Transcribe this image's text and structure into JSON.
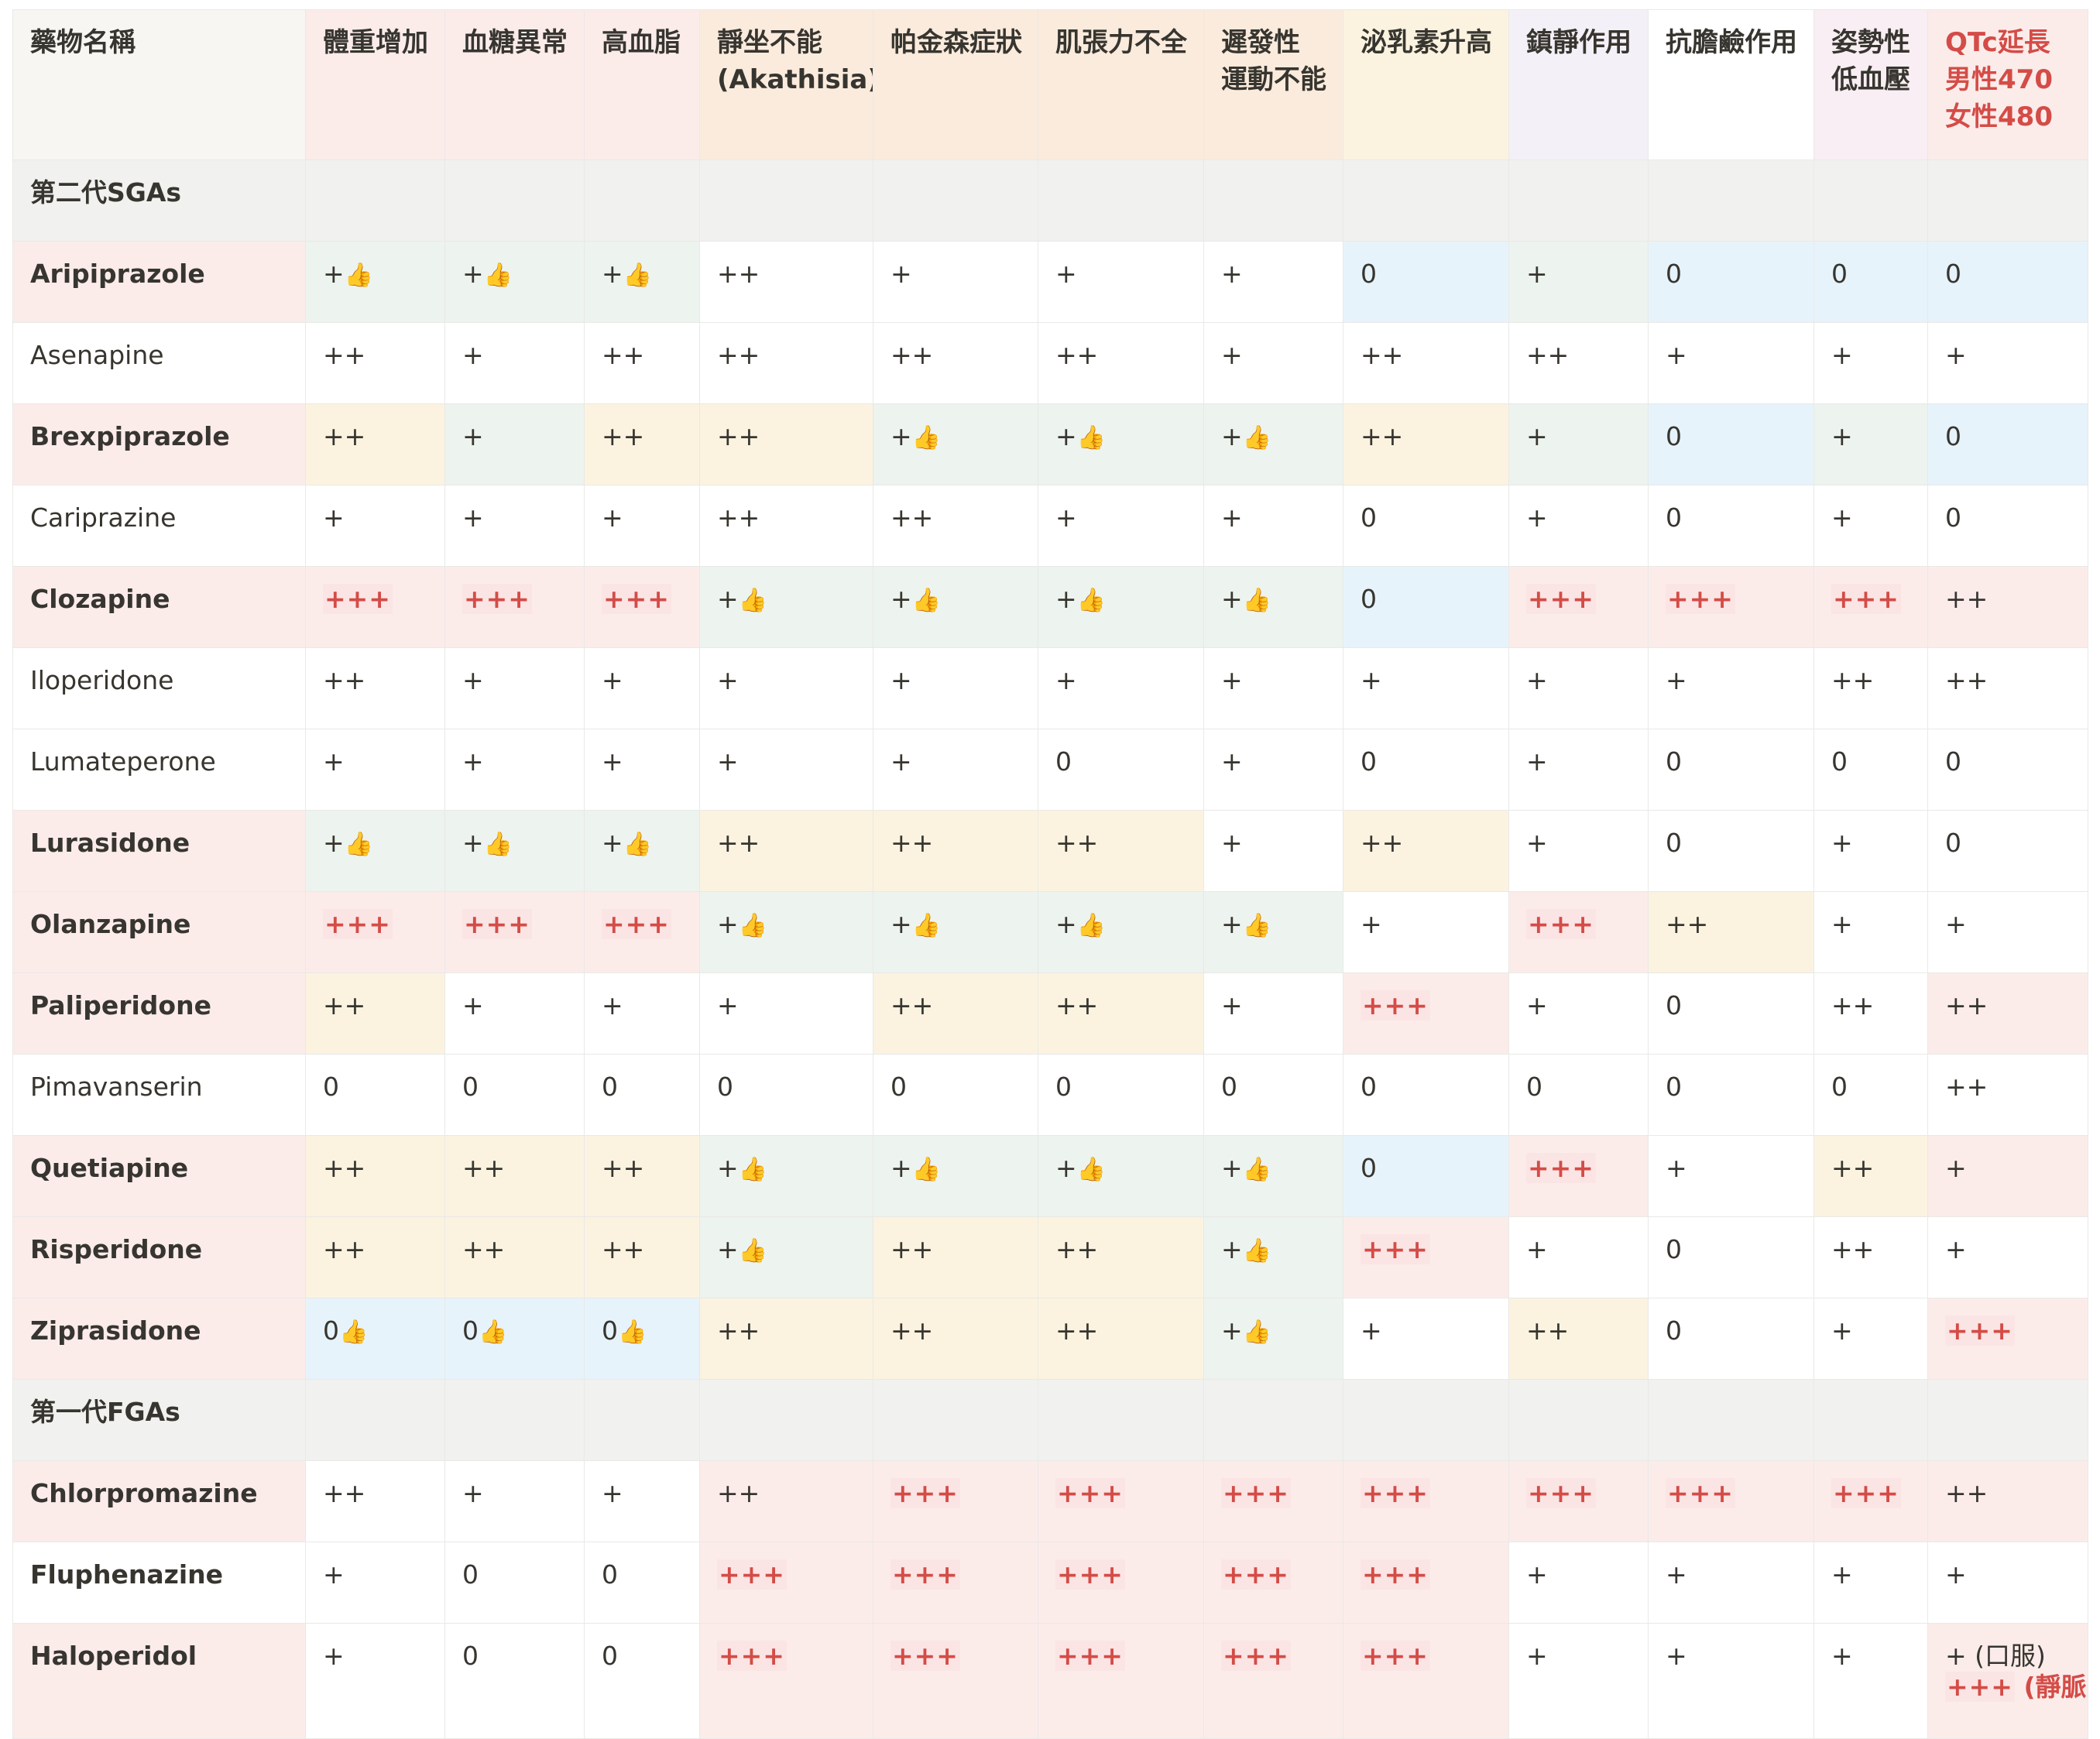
{
  "columns": [
    {
      "label": "藥物名稱",
      "bg": "bg-gray"
    },
    {
      "label": "體重增加",
      "bg": "bg-red"
    },
    {
      "label": "血糖異常",
      "bg": "bg-red"
    },
    {
      "label": "高血脂",
      "bg": "bg-red"
    },
    {
      "label": "靜坐不能\n(Akathisia)",
      "bg": "bg-orange"
    },
    {
      "label": "帕金森症狀",
      "bg": "bg-orange"
    },
    {
      "label": "肌張力不全",
      "bg": "bg-orange"
    },
    {
      "label": "遲發性\n運動不能",
      "bg": "bg-orange"
    },
    {
      "label": "泌乳素升高",
      "bg": "bg-yellow"
    },
    {
      "label": "鎮靜作用",
      "bg": "bg-purple"
    },
    {
      "label": "抗膽鹼作用",
      "bg": "bg-white"
    },
    {
      "label": "姿勢性\n低血壓",
      "bg": "bg-pink"
    },
    {
      "label": "QTc延長\n男性470\n女性480",
      "bg": "bg-red",
      "red": true
    }
  ],
  "rows": [
    {
      "section": "第二代SGAs"
    },
    {
      "name": "Aripiprazole",
      "bold": true,
      "nameBg": "bg-red",
      "cells": [
        [
          "+",
          "g",
          true
        ],
        [
          "+",
          "g",
          true
        ],
        [
          "+",
          "g",
          true
        ],
        [
          "++",
          "w"
        ],
        [
          "+",
          "w"
        ],
        [
          "+",
          "w"
        ],
        [
          "+",
          "w"
        ],
        [
          "0",
          "b"
        ],
        [
          "+",
          "g"
        ],
        [
          "0",
          "b"
        ],
        [
          "0",
          "b"
        ],
        [
          "0",
          "b"
        ]
      ]
    },
    {
      "name": "Asenapine",
      "bold": false,
      "nameBg": "bg-white",
      "cells": [
        [
          "++",
          "w"
        ],
        [
          "+",
          "w"
        ],
        [
          "++",
          "w"
        ],
        [
          "++",
          "w"
        ],
        [
          "++",
          "w"
        ],
        [
          "++",
          "w"
        ],
        [
          "+",
          "w"
        ],
        [
          "++",
          "w"
        ],
        [
          "++",
          "w"
        ],
        [
          "+",
          "w"
        ],
        [
          "+",
          "w"
        ],
        [
          "+",
          "w"
        ]
      ]
    },
    {
      "name": "Brexpiprazole",
      "bold": true,
      "nameBg": "bg-red",
      "cells": [
        [
          "++",
          "y"
        ],
        [
          "+",
          "g"
        ],
        [
          "++",
          "y"
        ],
        [
          "++",
          "y"
        ],
        [
          "+",
          "g",
          true
        ],
        [
          "+",
          "g",
          true
        ],
        [
          "+",
          "g",
          true
        ],
        [
          "++",
          "y"
        ],
        [
          "+",
          "g"
        ],
        [
          "0",
          "b"
        ],
        [
          "+",
          "g"
        ],
        [
          "0",
          "b"
        ]
      ]
    },
    {
      "name": "Cariprazine",
      "bold": false,
      "nameBg": "bg-white",
      "cells": [
        [
          "+",
          "w"
        ],
        [
          "+",
          "w"
        ],
        [
          "+",
          "w"
        ],
        [
          "++",
          "w"
        ],
        [
          "++",
          "w"
        ],
        [
          "+",
          "w"
        ],
        [
          "+",
          "w"
        ],
        [
          "0",
          "w"
        ],
        [
          "+",
          "w"
        ],
        [
          "0",
          "w"
        ],
        [
          "+",
          "w"
        ],
        [
          "0",
          "w"
        ]
      ]
    },
    {
      "name": "Clozapine",
      "bold": true,
      "nameBg": "bg-red",
      "cells": [
        [
          "+++",
          "r"
        ],
        [
          "+++",
          "r"
        ],
        [
          "+++",
          "r"
        ],
        [
          "+",
          "g",
          true
        ],
        [
          "+",
          "g",
          true
        ],
        [
          "+",
          "g",
          true
        ],
        [
          "+",
          "g",
          true
        ],
        [
          "0",
          "b"
        ],
        [
          "+++",
          "r"
        ],
        [
          "+++",
          "r"
        ],
        [
          "+++",
          "r"
        ],
        [
          "++",
          "r"
        ]
      ]
    },
    {
      "name": "Iloperidone",
      "bold": false,
      "nameBg": "bg-white",
      "cells": [
        [
          "++",
          "w"
        ],
        [
          "+",
          "w"
        ],
        [
          "+",
          "w"
        ],
        [
          "+",
          "w"
        ],
        [
          "+",
          "w"
        ],
        [
          "+",
          "w"
        ],
        [
          "+",
          "w"
        ],
        [
          "+",
          "w"
        ],
        [
          "+",
          "w"
        ],
        [
          "+",
          "w"
        ],
        [
          "++",
          "w"
        ],
        [
          "++",
          "w"
        ]
      ]
    },
    {
      "name": "Lumateperone",
      "bold": false,
      "nameBg": "bg-white",
      "cells": [
        [
          "+",
          "w"
        ],
        [
          "+",
          "w"
        ],
        [
          "+",
          "w"
        ],
        [
          "+",
          "w"
        ],
        [
          "+",
          "w"
        ],
        [
          "0",
          "w"
        ],
        [
          "+",
          "w"
        ],
        [
          "0",
          "w"
        ],
        [
          "+",
          "w"
        ],
        [
          "0",
          "w"
        ],
        [
          "0",
          "w"
        ],
        [
          "0",
          "w"
        ]
      ]
    },
    {
      "name": "Lurasidone",
      "bold": true,
      "nameBg": "bg-red",
      "cells": [
        [
          "+",
          "g",
          true
        ],
        [
          "+",
          "g",
          true
        ],
        [
          "+",
          "g",
          true
        ],
        [
          "++",
          "y"
        ],
        [
          "++",
          "y"
        ],
        [
          "++",
          "y"
        ],
        [
          "+",
          "w"
        ],
        [
          "++",
          "y"
        ],
        [
          "+",
          "w"
        ],
        [
          "0",
          "w"
        ],
        [
          "+",
          "w"
        ],
        [
          "0",
          "w"
        ]
      ]
    },
    {
      "name": "Olanzapine",
      "bold": true,
      "nameBg": "bg-red",
      "cells": [
        [
          "+++",
          "r"
        ],
        [
          "+++",
          "r"
        ],
        [
          "+++",
          "r"
        ],
        [
          "+",
          "g",
          true
        ],
        [
          "+",
          "g",
          true
        ],
        [
          "+",
          "g",
          true
        ],
        [
          "+",
          "g",
          true
        ],
        [
          "+",
          "w"
        ],
        [
          "+++",
          "r"
        ],
        [
          "++",
          "y"
        ],
        [
          "+",
          "w"
        ],
        [
          "+",
          "w"
        ]
      ]
    },
    {
      "name": "Paliperidone",
      "bold": true,
      "nameBg": "bg-red",
      "cells": [
        [
          "++",
          "y"
        ],
        [
          "+",
          "w"
        ],
        [
          "+",
          "w"
        ],
        [
          "+",
          "w"
        ],
        [
          "++",
          "y"
        ],
        [
          "++",
          "y"
        ],
        [
          "+",
          "w"
        ],
        [
          "+++",
          "r"
        ],
        [
          "+",
          "w"
        ],
        [
          "0",
          "w"
        ],
        [
          "++",
          "w"
        ],
        [
          "++",
          "r"
        ]
      ]
    },
    {
      "name": "Pimavanserin",
      "bold": false,
      "nameBg": "bg-white",
      "cells": [
        [
          "0",
          "w"
        ],
        [
          "0",
          "w"
        ],
        [
          "0",
          "w"
        ],
        [
          "0",
          "w"
        ],
        [
          "0",
          "w"
        ],
        [
          "0",
          "w"
        ],
        [
          "0",
          "w"
        ],
        [
          "0",
          "w"
        ],
        [
          "0",
          "w"
        ],
        [
          "0",
          "w"
        ],
        [
          "0",
          "w"
        ],
        [
          "++",
          "w"
        ]
      ]
    },
    {
      "name": "Quetiapine",
      "bold": true,
      "nameBg": "bg-red",
      "cells": [
        [
          "++",
          "y"
        ],
        [
          "++",
          "y"
        ],
        [
          "++",
          "y"
        ],
        [
          "+",
          "g",
          true
        ],
        [
          "+",
          "g",
          true
        ],
        [
          "+",
          "g",
          true
        ],
        [
          "+",
          "g",
          true
        ],
        [
          "0",
          "b"
        ],
        [
          "+++",
          "r"
        ],
        [
          "+",
          "w"
        ],
        [
          "++",
          "y"
        ],
        [
          "+",
          "r"
        ]
      ]
    },
    {
      "name": "Risperidone",
      "bold": true,
      "nameBg": "bg-red",
      "cells": [
        [
          "++",
          "y"
        ],
        [
          "++",
          "y"
        ],
        [
          "++",
          "y"
        ],
        [
          "+",
          "g",
          true
        ],
        [
          "++",
          "y"
        ],
        [
          "++",
          "y"
        ],
        [
          "+",
          "g",
          true
        ],
        [
          "+++",
          "r"
        ],
        [
          "+",
          "w"
        ],
        [
          "0",
          "w"
        ],
        [
          "++",
          "w"
        ],
        [
          "+",
          "w"
        ]
      ]
    },
    {
      "name": "Ziprasidone",
      "bold": true,
      "nameBg": "bg-red",
      "cells": [
        [
          "0",
          "b",
          true
        ],
        [
          "0",
          "b",
          true
        ],
        [
          "0",
          "b",
          true
        ],
        [
          "++",
          "y"
        ],
        [
          "++",
          "y"
        ],
        [
          "++",
          "y"
        ],
        [
          "+",
          "g",
          true
        ],
        [
          "+",
          "w"
        ],
        [
          "++",
          "y"
        ],
        [
          "0",
          "w"
        ],
        [
          "+",
          "w"
        ],
        [
          "+++",
          "r"
        ]
      ]
    },
    {
      "section": "第一代FGAs"
    },
    {
      "name": "Chlorpromazine",
      "bold": true,
      "nameBg": "bg-red",
      "cells": [
        [
          "++",
          "w"
        ],
        [
          "+",
          "w"
        ],
        [
          "+",
          "w"
        ],
        [
          "++",
          "r"
        ],
        [
          "+++",
          "r"
        ],
        [
          "+++",
          "r"
        ],
        [
          "+++",
          "r"
        ],
        [
          "+++",
          "r"
        ],
        [
          "+++",
          "r"
        ],
        [
          "+++",
          "r"
        ],
        [
          "+++",
          "r"
        ],
        [
          "++",
          "r"
        ]
      ]
    },
    {
      "name": "Fluphenazine",
      "bold": true,
      "nameBg": "bg-white",
      "cells": [
        [
          "+",
          "w"
        ],
        [
          "0",
          "w"
        ],
        [
          "0",
          "w"
        ],
        [
          "+++",
          "r"
        ],
        [
          "+++",
          "r"
        ],
        [
          "+++",
          "r"
        ],
        [
          "+++",
          "r"
        ],
        [
          "+++",
          "r"
        ],
        [
          "+",
          "w"
        ],
        [
          "+",
          "w"
        ],
        [
          "+",
          "w"
        ],
        [
          "+",
          "w"
        ]
      ]
    },
    {
      "name": "Haloperidol",
      "bold": true,
      "nameBg": "bg-red",
      "tall": true,
      "cells": [
        [
          "+",
          "w"
        ],
        [
          "0",
          "w"
        ],
        [
          "0",
          "w"
        ],
        [
          "+++",
          "r"
        ],
        [
          "+++",
          "r"
        ],
        [
          "+++",
          "r"
        ],
        [
          "+++",
          "r"
        ],
        [
          "+++",
          "r"
        ],
        [
          "+",
          "w"
        ],
        [
          "+",
          "w"
        ],
        [
          "+",
          "w"
        ],
        [
          "+ (口服)\n+++ (靜脈)",
          "r"
        ]
      ]
    }
  ]
}
